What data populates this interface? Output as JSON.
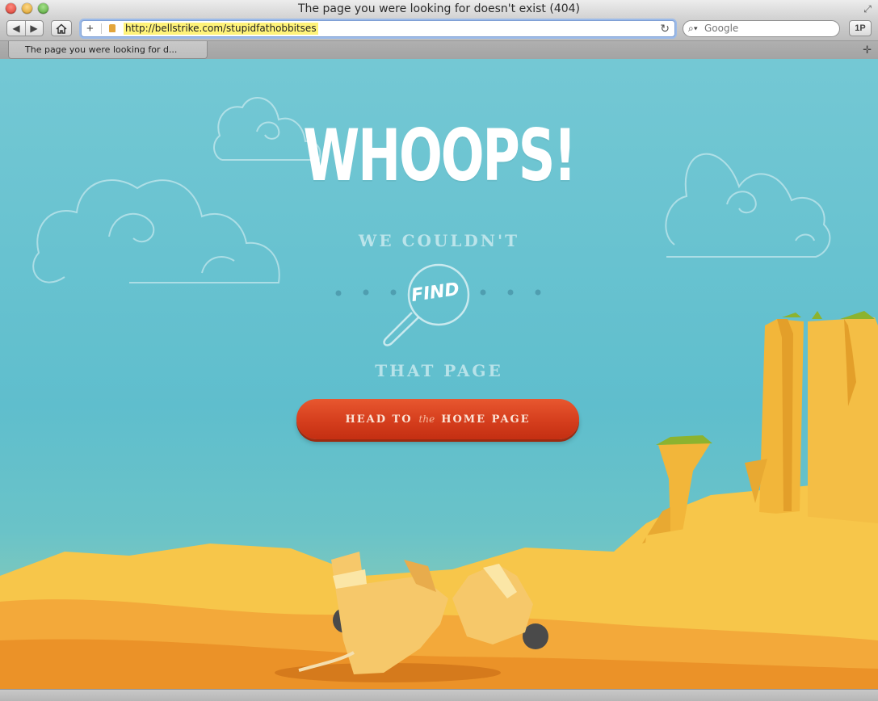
{
  "window": {
    "title": "The page you were looking for doesn't exist (404)"
  },
  "toolbar": {
    "url": "http://bellstrike.com/stupidfathobbitses",
    "search_placeholder": "Google",
    "back_icon": "chevron-left-icon",
    "forward_icon": "chevron-right-icon",
    "home_icon": "home-icon",
    "reload_icon": "reload-icon",
    "onepassword_label": "1P"
  },
  "tabs": [
    {
      "label": "The page you were looking for d..."
    }
  ],
  "page": {
    "headline": "WHOOPS!",
    "line1": "WE COULDN'T",
    "find_word": "FIND",
    "line2": "THAT PAGE",
    "button": {
      "part1": "HEAD TO",
      "part2": "the",
      "part3": "HOME PAGE"
    }
  },
  "colors": {
    "sky": "#67c1cf",
    "sand": "#f6c247",
    "button": "#d53e1d"
  }
}
